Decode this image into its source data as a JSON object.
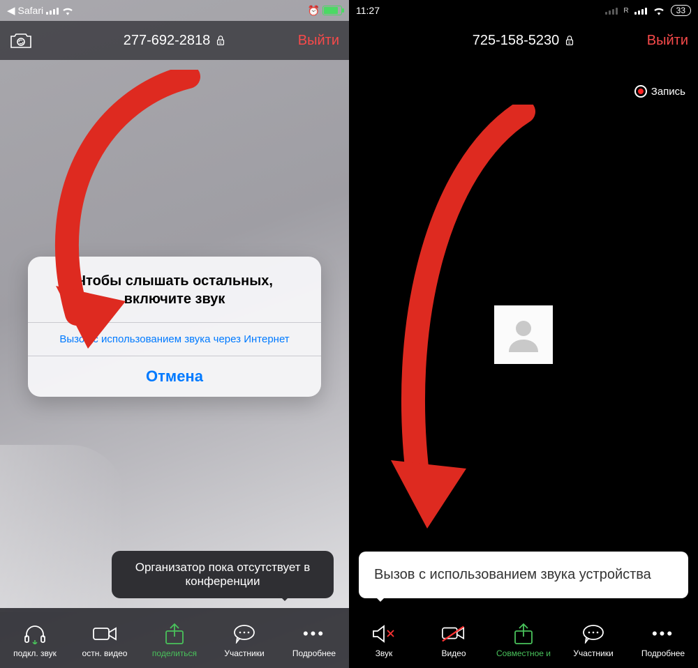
{
  "left": {
    "status": {
      "back_to": "Safari"
    },
    "meeting_id": "277-692-2818",
    "leave": "Выйти",
    "alert": {
      "title": "Чтобы слышать остальных, включите звук",
      "option": "Вызов с использованием звука через Интернет",
      "cancel": "Отмена"
    },
    "organizer_tip": "Организатор пока отсутствует в конференции",
    "toolbar": {
      "audio": "подкл. звук",
      "video": "остн. видео",
      "share": "поделиться",
      "participants": "Участники",
      "more": "Подробнее"
    }
  },
  "right": {
    "status": {
      "time": "11:27",
      "battery": "33"
    },
    "meeting_id": "725-158-5230",
    "leave": "Выйти",
    "recording": "Запись",
    "popup": "Вызов с использованием звука устройства",
    "toolbar": {
      "audio": "Звук",
      "video": "Видео",
      "share": "Совместное и",
      "participants": "Участники",
      "more": "Подробнее"
    }
  }
}
